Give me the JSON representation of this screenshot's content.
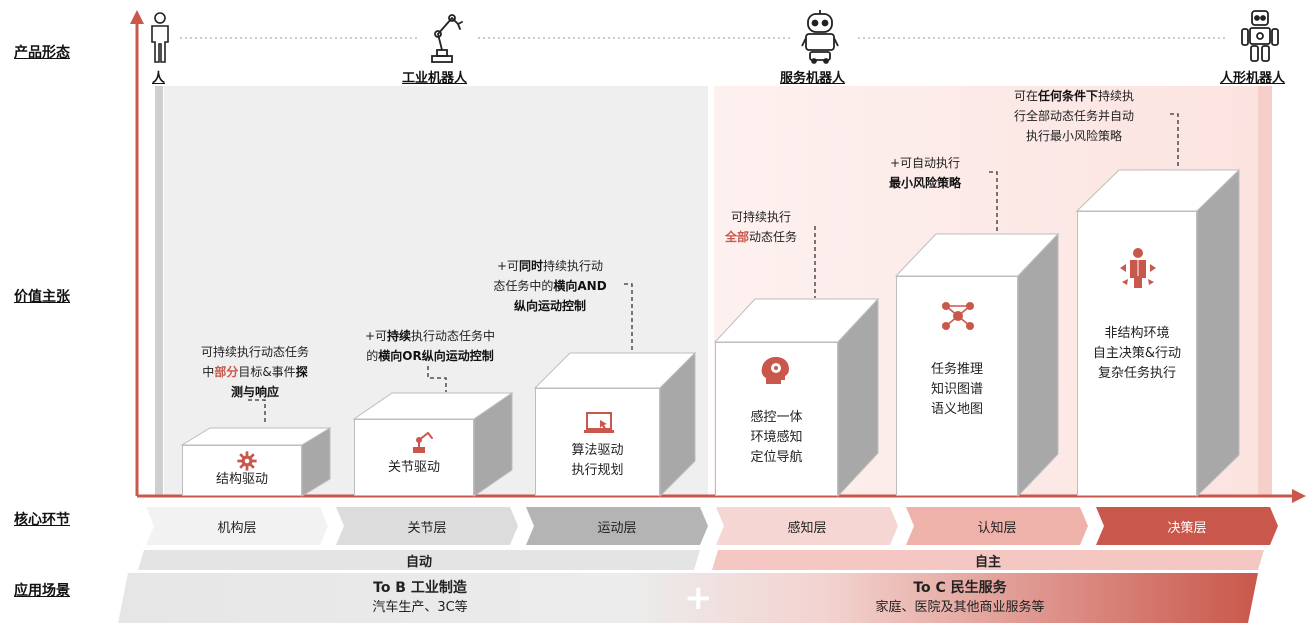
{
  "row_labels": {
    "product_form": "产品形态",
    "value_prop": "价值主张",
    "core_link": "核心环节",
    "scenario": "应用场景"
  },
  "products": [
    {
      "label": "人",
      "icon": "human-icon"
    },
    {
      "label": "工业机器人",
      "icon": "robot-arm-icon"
    },
    {
      "label": "服务机器人",
      "icon": "service-robot-icon"
    },
    {
      "label": "人形机器人",
      "icon": "humanoid-robot-icon"
    }
  ],
  "annotations": {
    "a1": {
      "l1": "可持续执行动态任务",
      "l2a": "中",
      "l2b": "部分",
      "l2c": "目标&事件",
      "l2d": "探",
      "l3": "测与响应"
    },
    "a2": {
      "l1a": "+可",
      "l1b": "持续",
      "l1c": "执行动态任务中",
      "l2a": "的",
      "l2b": "横向OR纵向运动控制"
    },
    "a3": {
      "l1a": "+可",
      "l1b": "同时",
      "l1c": "持续执行动",
      "l2a": "态任务中的",
      "l2b": "横向AND",
      "l3": "纵向运动控制"
    },
    "a4": {
      "l1": "可持续执行",
      "l2a": "全部",
      "l2b": "动态任务"
    },
    "a5": {
      "l1": "+可自动执行",
      "l2": "最小风险策略"
    },
    "a6": {
      "l1a": "可在",
      "l1b": "任何条件下",
      "l1c": "持续执",
      "l2": "行全部动态任务并自动",
      "l3": "执行最小风险策略"
    }
  },
  "boxes": [
    {
      "lines": [
        "结构驱动"
      ],
      "icon": "gear-icon"
    },
    {
      "lines": [
        "关节驱动"
      ],
      "icon": "robot-arm-icon"
    },
    {
      "lines": [
        "算法驱动",
        "执行规划"
      ],
      "icon": "laptop-icon"
    },
    {
      "lines": [
        "感控一体",
        "环境感知",
        "定位导航"
      ],
      "icon": "brain-gear-icon"
    },
    {
      "lines": [
        "任务推理",
        "知识图谱",
        "语义地图"
      ],
      "icon": "network-icon"
    },
    {
      "lines": [
        "非结构环境",
        "自主决策&行动",
        "复杂任务执行"
      ],
      "icon": "decision-person-icon"
    }
  ],
  "layers": [
    "机构层",
    "关节层",
    "运动层",
    "感知层",
    "认知层",
    "决策层"
  ],
  "modes": {
    "auto": "自动",
    "autonomous": "自主"
  },
  "scenarios": {
    "tob_title": "To B 工业制造",
    "tob_sub": "汽车生产、3C等",
    "toc_title": "To C 民生服务",
    "toc_sub": "家庭、医院及其他商业服务等",
    "plus": "+"
  },
  "colors": {
    "accent_red": "#c9574b",
    "light_red_bg": "#fbe6e4",
    "light_gray_bg": "#efefef",
    "axis_red": "#c9574b"
  }
}
